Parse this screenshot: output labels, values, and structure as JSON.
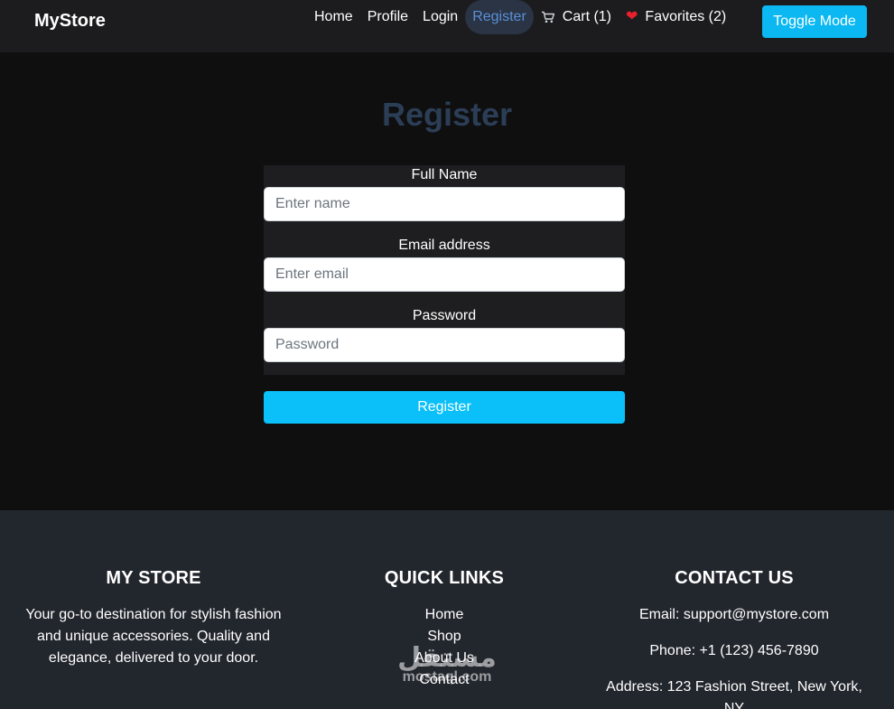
{
  "navbar": {
    "brand": "MyStore",
    "links": [
      {
        "label": "Home"
      },
      {
        "label": "Profile"
      },
      {
        "label": "Login"
      },
      {
        "label": "Register",
        "active": true
      },
      {
        "label": "Cart (1)",
        "icon": "cart-icon"
      },
      {
        "label": "Favorites (2)",
        "icon": "heart-icon"
      }
    ],
    "toggle_label": "Toggle Mode"
  },
  "main": {
    "title": "Register",
    "fields": [
      {
        "label": "Full Name",
        "placeholder": "Enter name",
        "value": ""
      },
      {
        "label": "Email address",
        "placeholder": "Enter email",
        "value": ""
      },
      {
        "label": "Password",
        "placeholder": "Password",
        "value": ""
      }
    ],
    "submit_label": "Register"
  },
  "footer": {
    "store": {
      "heading": "MY STORE",
      "text_lines": [
        "Your go-to destination for stylish fashion",
        "and unique accessories. Quality and",
        "elegance, delivered to your door."
      ]
    },
    "quick_links": {
      "heading": "QUICK LINKS",
      "items": [
        "Home",
        "Shop",
        "About Us",
        "Contact"
      ]
    },
    "contact": {
      "heading": "CONTACT US",
      "email": "Email: support@mystore.com",
      "phone": "Phone: +1 (123) 456-7890",
      "address_lines": [
        "Address: 123 Fashion Street, New York,",
        "NY"
      ]
    }
  },
  "watermark": {
    "arabic": "مستقل",
    "latin": "mostaql.com"
  },
  "colors": {
    "accent": "#0bb8f2",
    "active_nav_text": "#5a8fd8",
    "heart": "#e8202e",
    "title": "#2c3e56"
  }
}
